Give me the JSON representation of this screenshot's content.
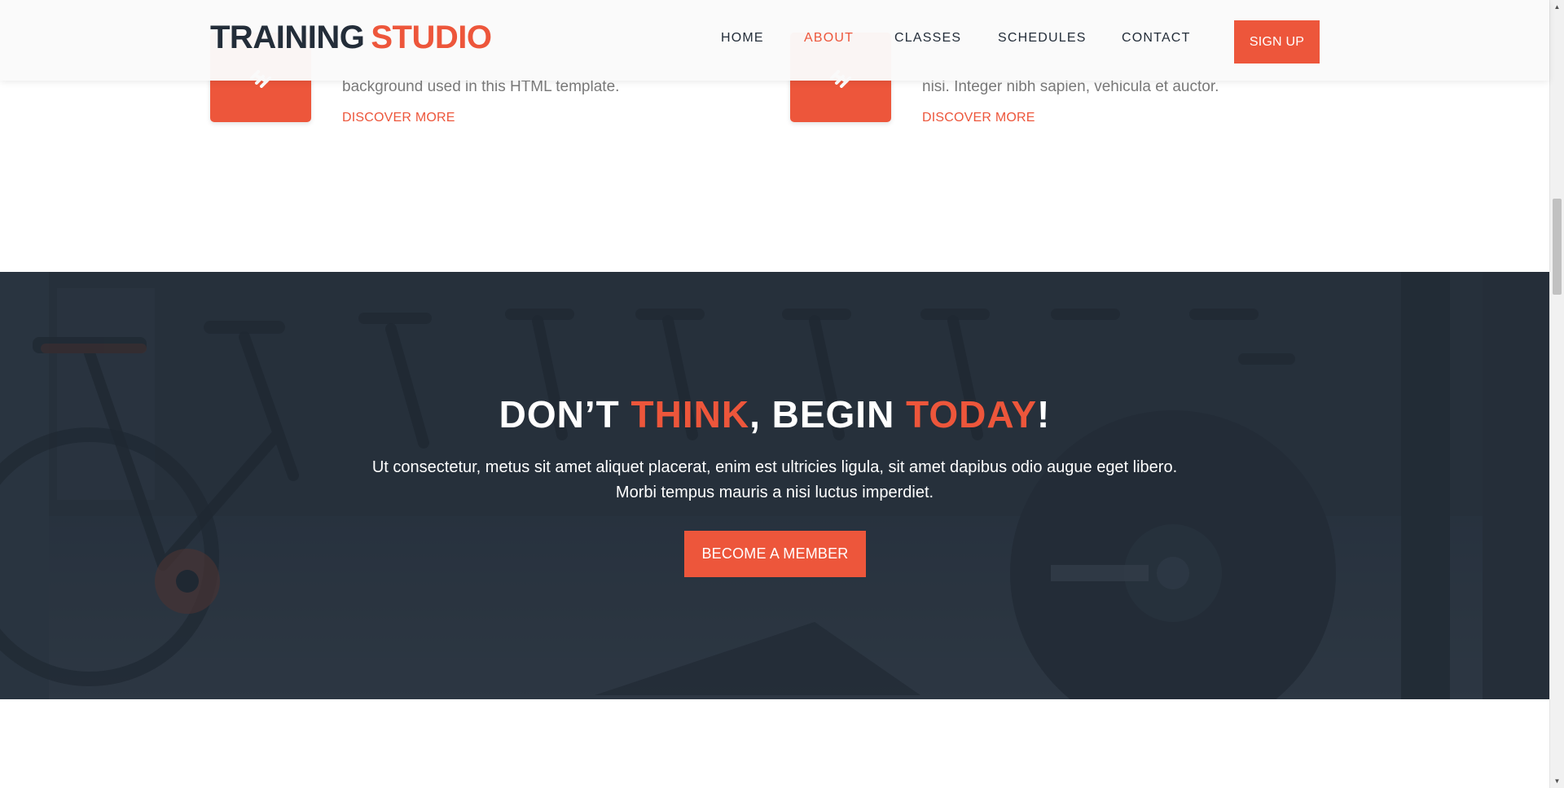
{
  "header": {
    "logo_part1": "TRAINING",
    "logo_part2": "STUDIO",
    "nav": [
      "HOME",
      "ABOUT",
      "CLASSES",
      "SCHEDULES",
      "CONTACT"
    ],
    "active_nav": "ABOUT",
    "signup_label": "SIGN UP"
  },
  "features": [
    {
      "icon": "dumbbell-icon",
      "description": "background used in this HTML template.",
      "link": "DISCOVER MORE"
    },
    {
      "icon": "dumbbell-icon",
      "description": "nisi. Integer nibh sapien, vehicula et auctor.",
      "link": "DISCOVER MORE"
    }
  ],
  "cta": {
    "title_part1": "DON’T ",
    "title_part2": "THINK",
    "title_part3": ", BEGIN ",
    "title_part4": "TODAY",
    "title_part5": "!",
    "text_line1": "Ut consectetur, metus sit amet aliquet placerat, enim est ultricies ligula, sit amet dapibus odio augue eget libero.",
    "text_line2": "Morbi tempus mauris a nisi luctus imperdiet.",
    "button_label": "BECOME A MEMBER"
  },
  "colors": {
    "accent": "#ed563b",
    "dark": "#232d39",
    "text_muted": "#7a7a7a"
  }
}
